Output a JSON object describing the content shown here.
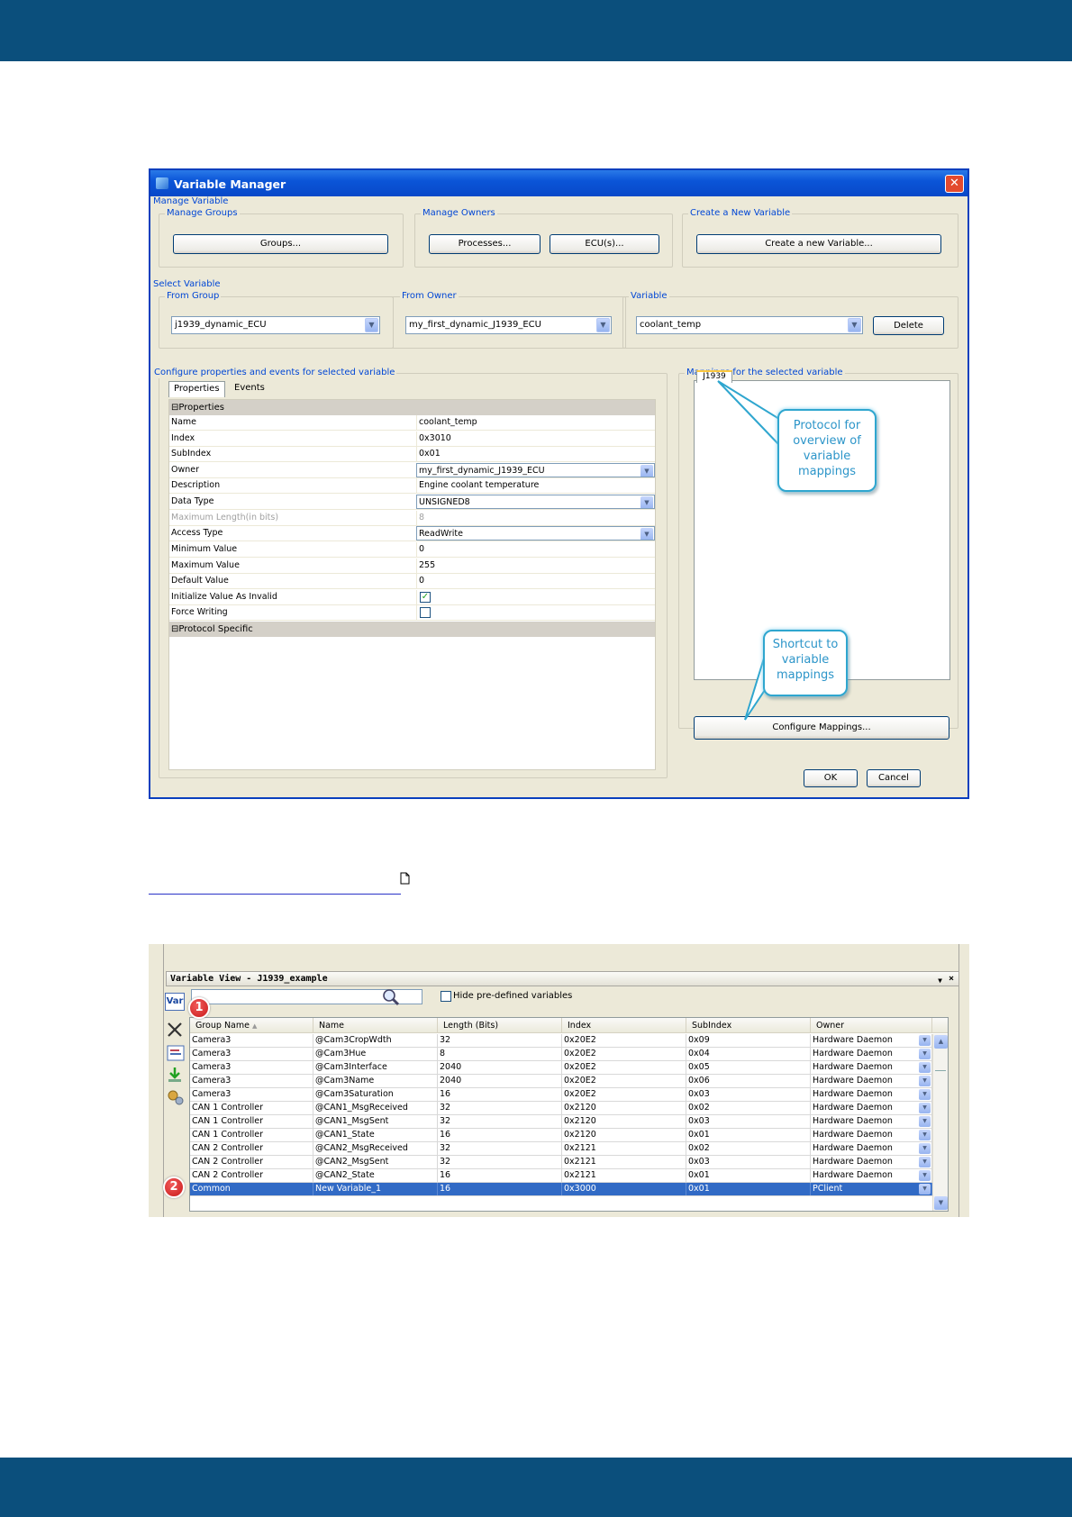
{
  "dialog": {
    "title": "Variable Manager",
    "manage_variable": "Manage Variable",
    "manage_groups": {
      "legend": "Manage Groups",
      "button": "Groups..."
    },
    "manage_owners": {
      "legend": "Manage Owners",
      "processes": "Processes...",
      "ecus": "ECU(s)..."
    },
    "create_new": {
      "legend": "Create a New Variable",
      "button": "Create a new Variable..."
    },
    "select_variable": "Select Variable",
    "from_group": {
      "legend": "From Group",
      "value": "j1939_dynamic_ECU"
    },
    "from_owner": {
      "legend": "From Owner",
      "value": "my_first_dynamic_J1939_ECU"
    },
    "variable": {
      "legend": "Variable",
      "value": "coolant_temp",
      "delete": "Delete"
    },
    "configure": {
      "legend": "Configure properties and events for selected variable",
      "tabs": [
        "Properties",
        "Events"
      ],
      "category_properties": "Properties",
      "category_protocol": "Protocol Specific",
      "rows": [
        {
          "name": "Name",
          "value": "coolant_temp"
        },
        {
          "name": "Index",
          "value": "0x3010"
        },
        {
          "name": "SubIndex",
          "value": "0x01"
        },
        {
          "name": "Owner",
          "value": "my_first_dynamic_J1939_ECU"
        },
        {
          "name": "Description",
          "value": "Engine coolant temperature"
        },
        {
          "name": "Data Type",
          "value": "UNSIGNED8"
        },
        {
          "name": "Maximum Length(in bits)",
          "value": "8"
        },
        {
          "name": "Access Type",
          "value": "ReadWrite"
        },
        {
          "name": "Minimum Value",
          "value": "0"
        },
        {
          "name": "Maximum Value",
          "value": "255"
        },
        {
          "name": "Default Value",
          "value": "0"
        },
        {
          "name": "Initialize Value As Invalid",
          "checked": true
        },
        {
          "name": "Force Writing",
          "checked": false
        }
      ]
    },
    "mappings": {
      "legend": "Mappings for the selected variable",
      "tab": "J1939",
      "configure_button": "Configure Mappings..."
    },
    "callouts": {
      "protocol": "Protocol for overview of variable mappings",
      "shortcut": "Shortcut to variable mappings"
    },
    "ok": "OK",
    "cancel": "Cancel"
  },
  "variable_view": {
    "title": "Variable View - J1939_example",
    "hide_predefined": "Hide pre-defined variables",
    "columns": [
      "Group Name",
      "Name",
      "Length (Bits)",
      "Index",
      "SubIndex",
      "Owner"
    ],
    "rows": [
      [
        "Camera3",
        "@Cam3CropWdth",
        "32",
        "0x20E2",
        "0x09",
        "Hardware Daemon"
      ],
      [
        "Camera3",
        "@Cam3Hue",
        "8",
        "0x20E2",
        "0x04",
        "Hardware Daemon"
      ],
      [
        "Camera3",
        "@Cam3Interface",
        "2040",
        "0x20E2",
        "0x05",
        "Hardware Daemon"
      ],
      [
        "Camera3",
        "@Cam3Name",
        "2040",
        "0x20E2",
        "0x06",
        "Hardware Daemon"
      ],
      [
        "Camera3",
        "@Cam3Saturation",
        "16",
        "0x20E2",
        "0x03",
        "Hardware Daemon"
      ],
      [
        "CAN 1 Controller",
        "@CAN1_MsgReceived",
        "32",
        "0x2120",
        "0x02",
        "Hardware Daemon"
      ],
      [
        "CAN 1 Controller",
        "@CAN1_MsgSent",
        "32",
        "0x2120",
        "0x03",
        "Hardware Daemon"
      ],
      [
        "CAN 1 Controller",
        "@CAN1_State",
        "16",
        "0x2120",
        "0x01",
        "Hardware Daemon"
      ],
      [
        "CAN 2 Controller",
        "@CAN2_MsgReceived",
        "32",
        "0x2121",
        "0x02",
        "Hardware Daemon"
      ],
      [
        "CAN 2 Controller",
        "@CAN2_MsgSent",
        "32",
        "0x2121",
        "0x03",
        "Hardware Daemon"
      ],
      [
        "CAN 2 Controller",
        "@CAN2_State",
        "16",
        "0x2121",
        "0x01",
        "Hardware Daemon"
      ],
      [
        "Common",
        "New Variable_1",
        "16",
        "0x3000",
        "0x01",
        "PClient"
      ]
    ],
    "badges": [
      "1",
      "2"
    ],
    "side_icon_label": "Var"
  },
  "icons": [
    "window-icon",
    "close-icon",
    "document-icon",
    "search-icon",
    "add-variable-icon",
    "delete-icon",
    "edit-icon",
    "import-icon",
    "tools-icon"
  ]
}
